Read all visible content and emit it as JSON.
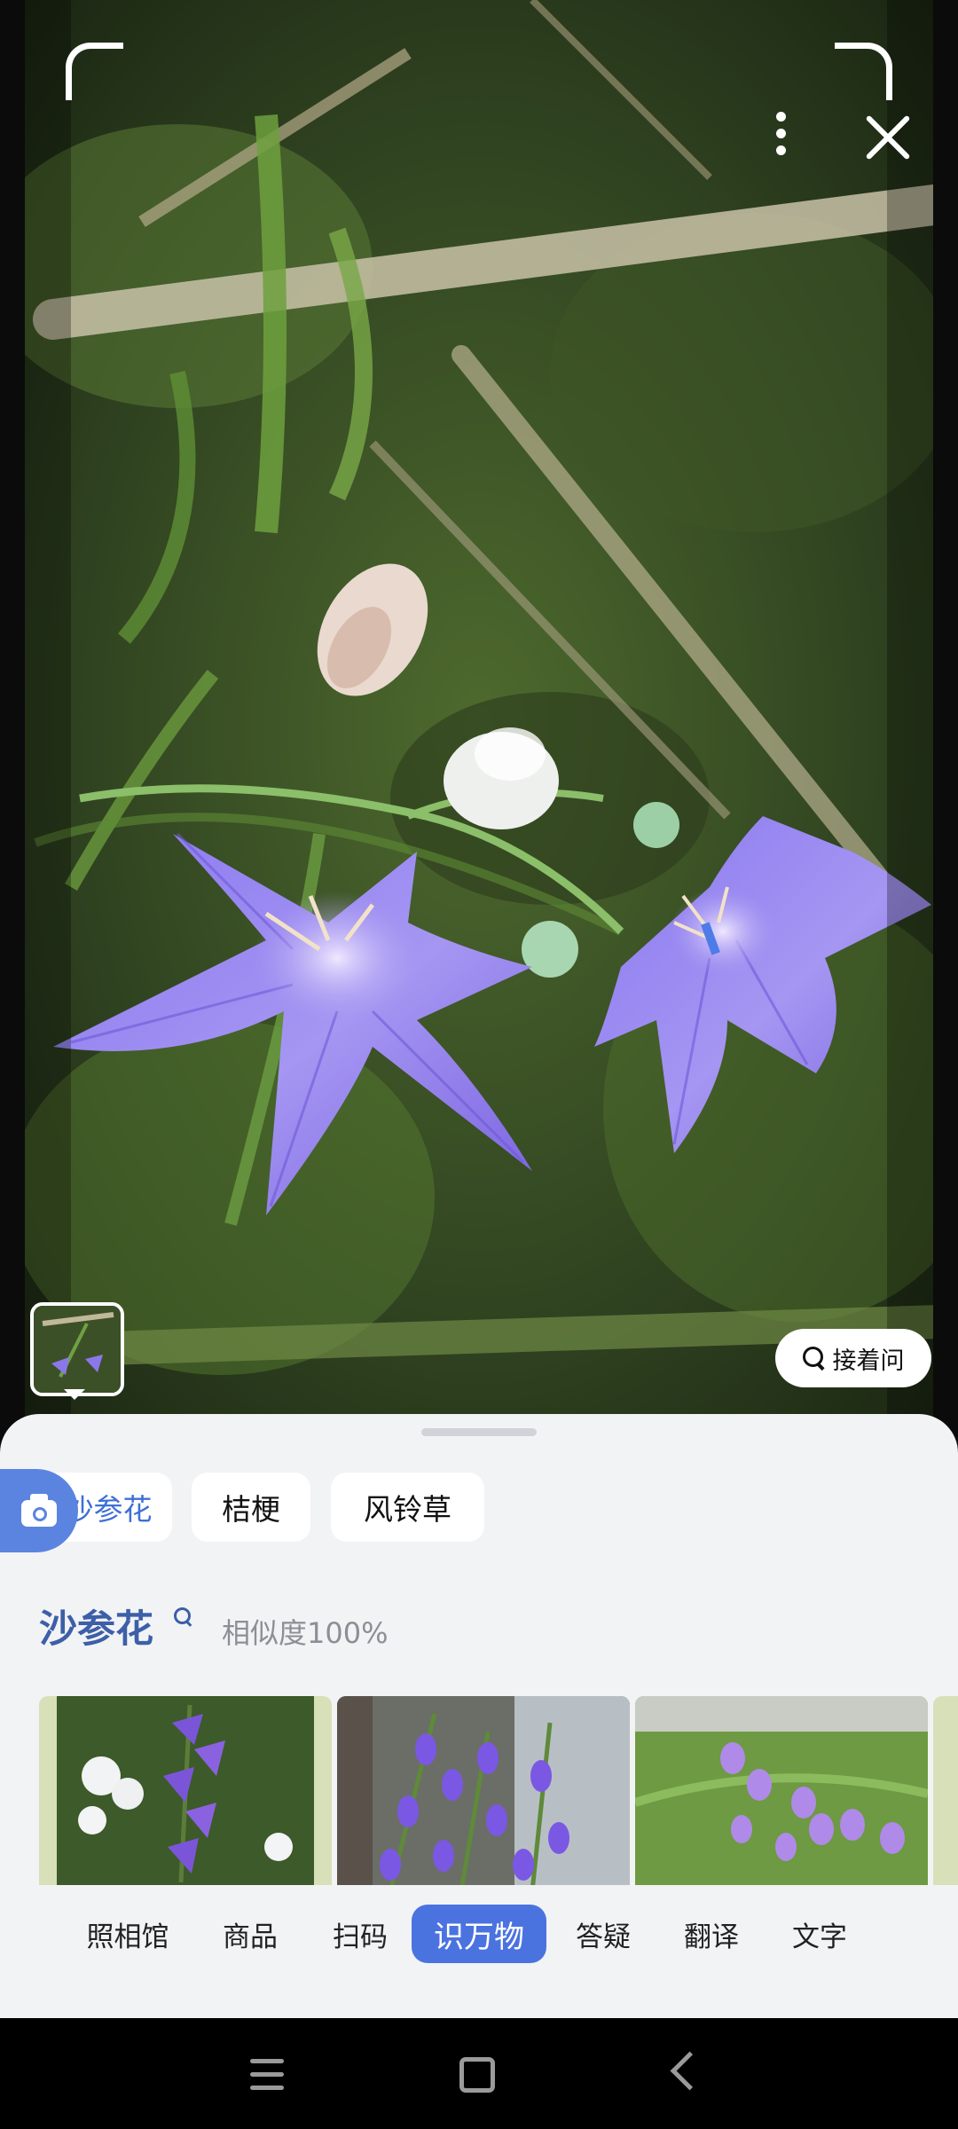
{
  "camera": {
    "more_icon": "more-vertical-icon",
    "close_icon": "close-icon",
    "ask_button_label": "接着问",
    "ask_icon": "search-icon"
  },
  "sheet": {
    "camera_icon": "camera-icon",
    "candidates": [
      {
        "label": "沙参花",
        "selected": true
      },
      {
        "label": "桔梗",
        "selected": false
      },
      {
        "label": "风铃草",
        "selected": false
      }
    ],
    "result": {
      "name": "沙参花",
      "similarity": "相似度100%"
    },
    "accent_color": "#4b73e0",
    "title_color": "#3d5fa8"
  },
  "tabs": {
    "items": [
      {
        "label": "照相馆"
      },
      {
        "label": "商品"
      },
      {
        "label": "扫码"
      },
      {
        "label": "识万物",
        "active": true
      },
      {
        "label": "答疑"
      },
      {
        "label": "翻译"
      },
      {
        "label": "文字"
      }
    ]
  },
  "navbar": {
    "menu_icon": "menu-icon",
    "home_icon": "home-icon",
    "back_icon": "back-icon"
  }
}
